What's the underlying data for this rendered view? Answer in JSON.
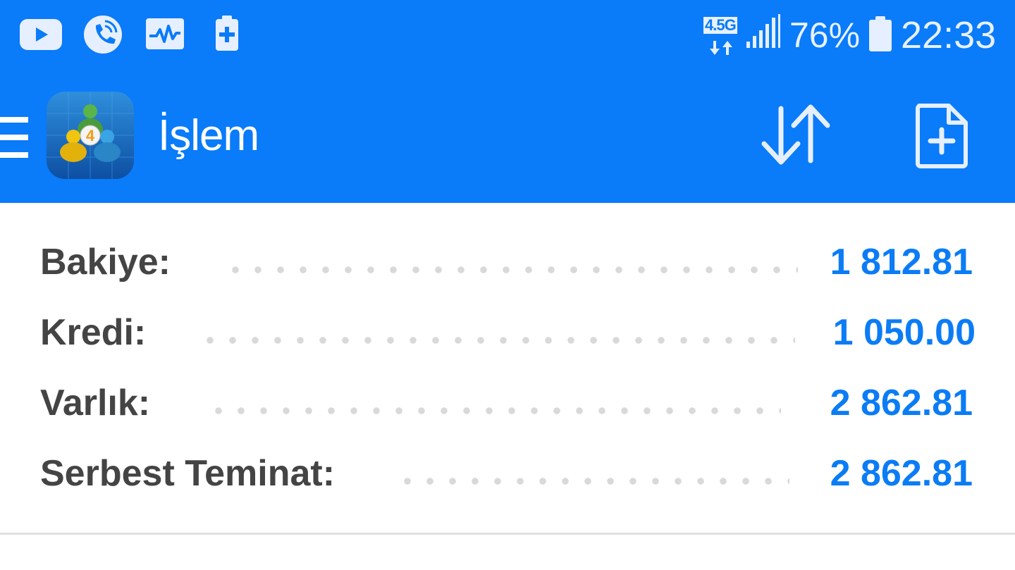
{
  "status_bar": {
    "network_type": "4.5G",
    "battery_percent": "76%",
    "time": "22:33",
    "notification_icons": [
      "youtube-icon",
      "phone-call-icon",
      "activity-monitor-icon",
      "battery-charge-icon"
    ],
    "system_icons": [
      "network-data-icon",
      "signal-strength-icon",
      "battery-icon"
    ]
  },
  "app_bar": {
    "title": "İşlem",
    "icons": [
      "menu-icon",
      "metatrader-logo",
      "sort-icon",
      "new-order-icon"
    ]
  },
  "account": {
    "rows": [
      {
        "label": "Bakiye:",
        "value": "1 812.81"
      },
      {
        "label": "Kredi:",
        "value": "1 050.00"
      },
      {
        "label": "Varlık:",
        "value": "2 862.81"
      },
      {
        "label": "Serbest Teminat:",
        "value": "2 862.81"
      }
    ]
  },
  "colors": {
    "primary": "#0a7bf9",
    "value_text": "#0b7cf5",
    "label_text": "#444444",
    "dot_leader": "#d9d9d9"
  }
}
